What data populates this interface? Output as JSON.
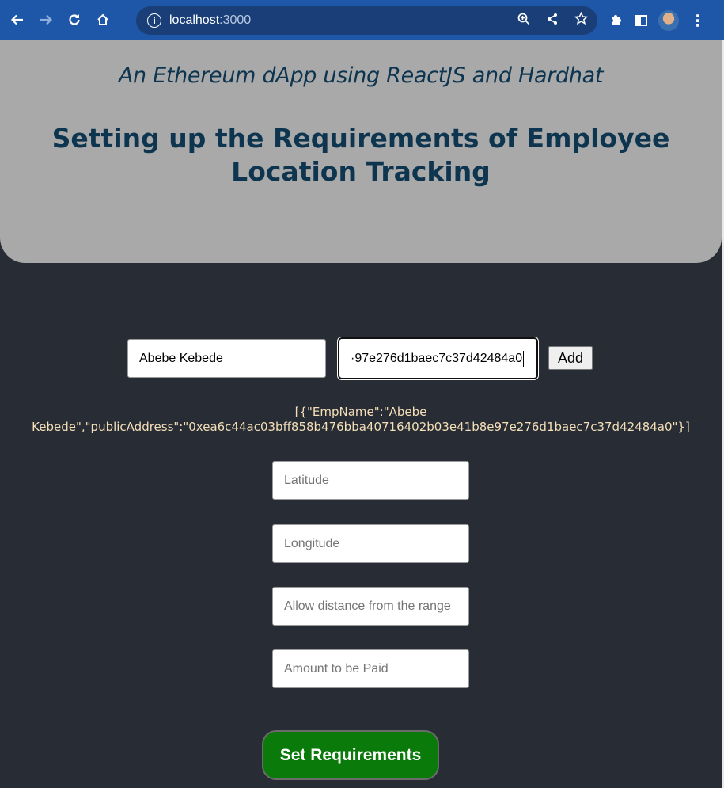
{
  "browser": {
    "host": "localhost",
    "port": ":3000",
    "icons": [
      "back-arrow-icon",
      "forward-arrow-icon",
      "reload-icon",
      "home-icon",
      "info-icon",
      "zoom-icon",
      "share-icon",
      "bookmark-star-icon",
      "extensions-icon",
      "side-panel-icon",
      "profile-avatar",
      "menu-kebab-icon"
    ]
  },
  "header": {
    "subtitle": "An Ethereum dApp using ReactJS and Hardhat",
    "title": "Setting up the Requirements of Employee Location Tracking"
  },
  "employee_form": {
    "name_value": "Abebe Kebede",
    "address_value": "·97e276d1baec7c37d42484a0",
    "add_label": "Add"
  },
  "employees_json": "[{\"EmpName\":\"Abebe Kebede\",\"publicAddress\":\"0xea6c44ac03bff858b476bba40716402b03e41b8e97e276d1baec7c37d42484a0\"}]",
  "requirements_form": {
    "latitude_placeholder": "Latitude",
    "longitude_placeholder": "Longitude",
    "distance_placeholder": "Allow distance from the range",
    "amount_placeholder": "Amount to be Paid",
    "submit_label": "Set Requirements"
  },
  "colors": {
    "chrome": "#1f57a8",
    "header_bg": "#a9a9a9",
    "title": "#0e3550",
    "page_bg": "#282c34",
    "json_text": "#f3dfb8",
    "submit_bg": "#0a7a0a"
  }
}
